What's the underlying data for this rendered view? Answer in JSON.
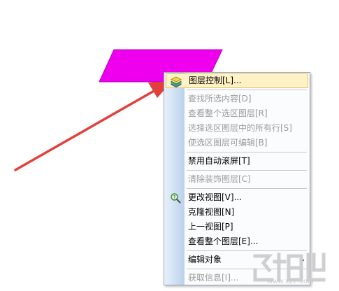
{
  "colors": {
    "shape_fill": "#ee00ee",
    "arrow": "#e2403c",
    "highlight_bg": "#fff2c4",
    "disabled_text": "#9b9b9b"
  },
  "context_menu": {
    "items": [
      {
        "label": "图层控制[L]...",
        "enabled": true,
        "highlighted": true,
        "icon": "layers-icon"
      },
      {
        "separator": true
      },
      {
        "label": "查找所选内容[D]",
        "enabled": false
      },
      {
        "label": "查看整个选区图层[R]",
        "enabled": false
      },
      {
        "label": "选择选区图层中的所有行[S]",
        "enabled": false
      },
      {
        "label": "使选区图层可编辑[B]",
        "enabled": false
      },
      {
        "separator": true
      },
      {
        "label": "禁用自动滚屏[T]",
        "enabled": true
      },
      {
        "separator": true
      },
      {
        "label": "清除装饰图层[C]",
        "enabled": false
      },
      {
        "separator": true
      },
      {
        "label": "更改视图[V]...",
        "enabled": true,
        "icon": "view-magnifier-icon"
      },
      {
        "label": "克隆视图[N]",
        "enabled": true
      },
      {
        "label": "上一视图[P]",
        "enabled": true
      },
      {
        "label": "查看整个图层[E]...",
        "enabled": true
      },
      {
        "separator": true
      },
      {
        "label": "编辑对象",
        "enabled": true,
        "submenu": true
      },
      {
        "separator": true
      },
      {
        "label": "获取信息[I]...",
        "enabled": false
      }
    ]
  },
  "watermark": {
    "site": "www.xz7.com"
  }
}
